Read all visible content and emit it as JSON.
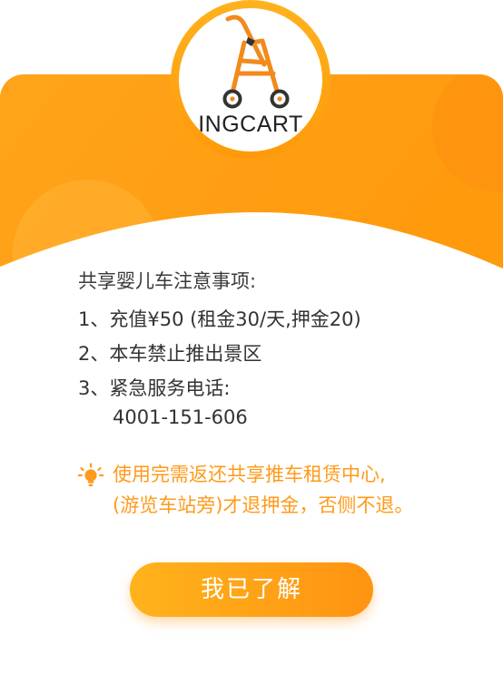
{
  "logo": {
    "brand_text": "INGCART",
    "icon": "stroller-icon"
  },
  "notice_panel": {
    "heading": "共享婴儿车注意事项:",
    "items": [
      "1、充值¥50 (租金30/天,押金20)",
      "2、本车禁止推出景区",
      "3、紧急服务电话:"
    ],
    "phone": "4001-151-606"
  },
  "tip": {
    "icon": "lightbulb-icon",
    "line1": "使用完需返还共享推车租赁中心,",
    "line2": "(游览车站旁)才退押金，否侧不退。"
  },
  "confirm_button": {
    "label": "我已了解"
  },
  "colors": {
    "accent": "#ff9a0a",
    "accent_light": "#ffb21e",
    "tip_text": "#ff9a1a",
    "body_text": "#333333"
  }
}
